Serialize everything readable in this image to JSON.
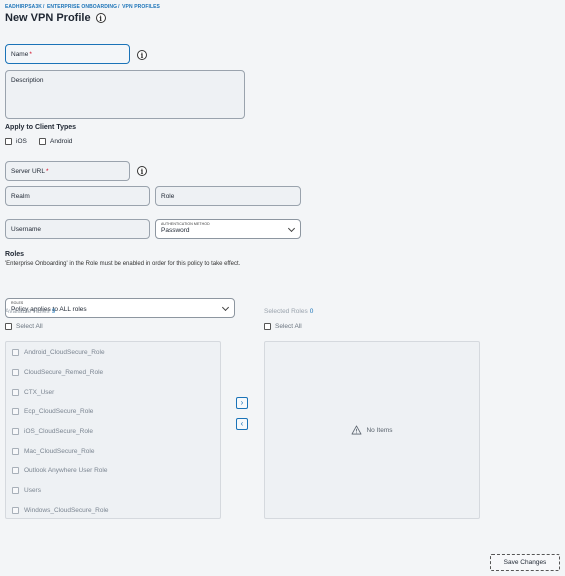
{
  "breadcrumb": [
    "EADHIRPSA3K",
    "ENTERPRISE ONBOARDING",
    "VPN PROFILES"
  ],
  "page": {
    "title": "New VPN Profile"
  },
  "form": {
    "name_placeholder": "Name",
    "description_placeholder": "Description",
    "client_types_label": "Apply to Client Types",
    "client_types": [
      {
        "label": "iOS",
        "checked": false
      },
      {
        "label": "Android",
        "checked": false
      }
    ],
    "server_url_placeholder": "Server URL",
    "realm_placeholder": "Realm",
    "role_placeholder": "Role",
    "username_placeholder": "Username",
    "auth_method": {
      "caption": "AUTHENTICATION METHOD",
      "value": "Password"
    }
  },
  "roles": {
    "heading": "Roles",
    "note": "'Enterprise Onboarding' in the Role must be enabled in order for this policy to take effect.",
    "select": {
      "caption": "ROLES",
      "value": "Policy applies to ALL roles"
    },
    "available": {
      "label": "Available Roles",
      "count": "9",
      "select_all": "Select All",
      "items": [
        "Android_CloudSecure_Role",
        "CloudSecure_Remed_Role",
        "CTX_User",
        "Ecp_CloudSecure_Role",
        "iOS_CloudSecure_Role",
        "Mac_CloudSecure_Role",
        "Outlook Anywhere User Role",
        "Users",
        "Windows_CloudSecure_Role"
      ]
    },
    "selected": {
      "label": "Selected Roles",
      "count": "0",
      "select_all": "Select All",
      "empty_text": "No Items"
    },
    "move_right": "›",
    "move_left": "‹"
  },
  "actions": {
    "save_label": "Save Changes"
  },
  "colors": {
    "accent": "#1a73b8",
    "required": "#d0021b",
    "background": "#f3f5f7"
  }
}
